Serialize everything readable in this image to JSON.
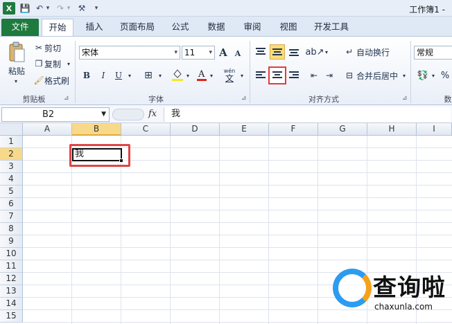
{
  "app": {
    "icon_letter": "X",
    "quick_access": [
      "💾",
      "↶",
      "▾",
      "↷",
      "▾",
      "⚒",
      "▾"
    ],
    "title": "工作簿1 -"
  },
  "tabs": [
    "文件",
    "开始",
    "插入",
    "页面布局",
    "公式",
    "数据",
    "审阅",
    "视图",
    "开发工具"
  ],
  "ribbon": {
    "clipboard": {
      "paste": "粘贴",
      "cut": "剪切",
      "copy": "复制",
      "format_painter": "格式刷",
      "label": "剪贴板"
    },
    "font": {
      "font_name": "宋体",
      "font_size": "11",
      "bold": "B",
      "italic": "I",
      "underline": "U",
      "grow": "A",
      "shrink": "A",
      "wen": "wén",
      "wen_char": "文",
      "label": "字体"
    },
    "alignment": {
      "wrap_text": "自动换行",
      "merge_center": "合并后居中",
      "label": "对齐方式"
    },
    "number": {
      "format": "常规",
      "percent": "%",
      "label_partial": "数"
    }
  },
  "formula_bar": {
    "name_box": "B2",
    "fx": "fx",
    "content": "我"
  },
  "grid": {
    "columns": [
      "A",
      "B",
      "C",
      "D",
      "E",
      "F",
      "G",
      "H",
      "I"
    ],
    "rows": [
      "1",
      "2",
      "3",
      "4",
      "5",
      "6",
      "7",
      "8",
      "9",
      "10",
      "11",
      "12",
      "13",
      "14",
      "15"
    ],
    "selected_column": "B",
    "selected_row": "2",
    "active_cell_value": "我"
  },
  "watermark": {
    "title": "查询啦",
    "subtitle": "chaxunla.com"
  },
  "colors": {
    "file_tab": "#1f7a3e",
    "highlight_gold": "#fbdc7a",
    "annotation_red": "#e23b3b"
  }
}
